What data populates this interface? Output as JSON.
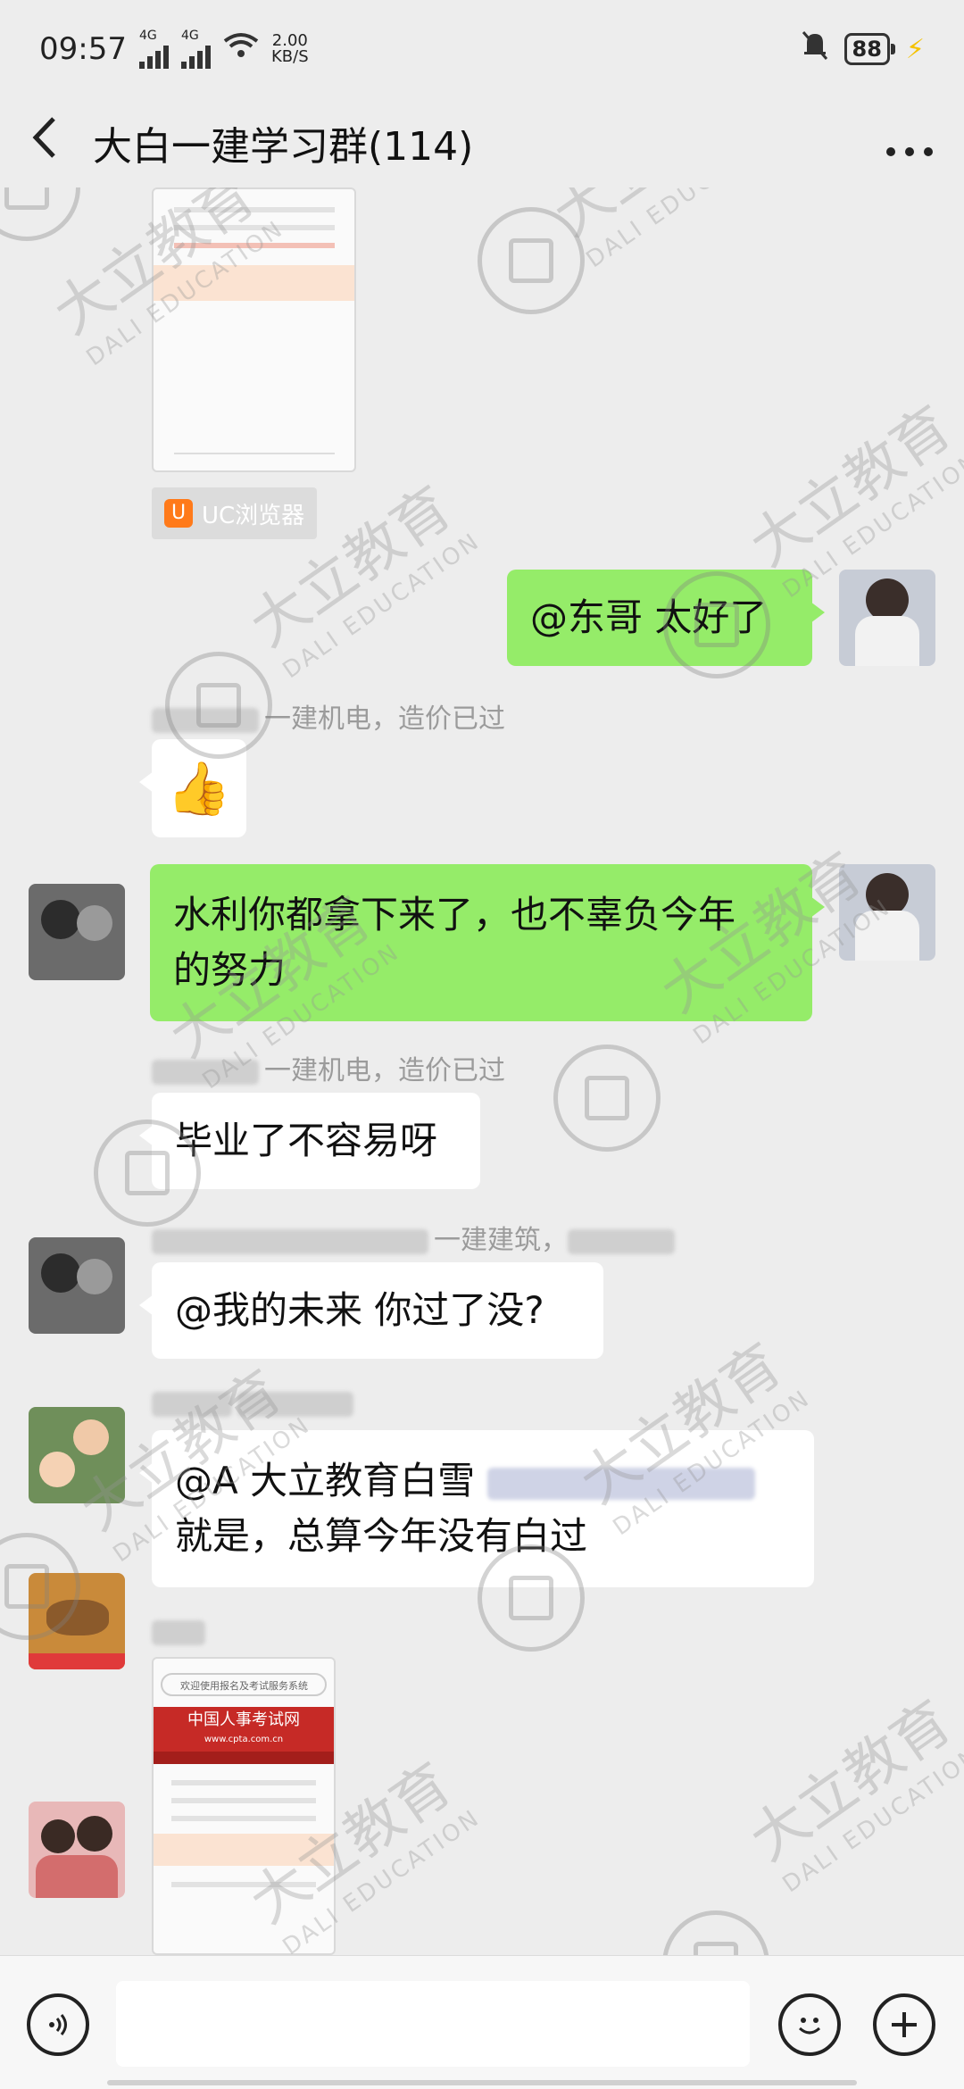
{
  "status_bar": {
    "time": "09:57",
    "net1": "4G",
    "net2": "4G",
    "speed_value": "2.00",
    "speed_unit": "KB/S",
    "battery": "88"
  },
  "header": {
    "title": "大白一建学习群(114)",
    "back_icon": "chevron-left-icon",
    "more_icon": "more-dots-icon"
  },
  "messages": [
    {
      "type": "image",
      "side": "left",
      "source_label": "UC浏览器"
    },
    {
      "type": "text",
      "side": "right",
      "text": "@东哥  太好了"
    },
    {
      "type": "emoji",
      "side": "left",
      "sender_visible": "一建机电，造价已过",
      "emoji": "👍"
    },
    {
      "type": "text",
      "side": "right",
      "text_line1": "水利你都拿下来了，也不辜负今年",
      "text_line2": "的努力"
    },
    {
      "type": "text",
      "side": "left",
      "sender_visible": "一建机电，造价已过",
      "text": "毕业了不容易呀"
    },
    {
      "type": "text",
      "side": "left",
      "sender_visible": "一建建筑，",
      "text": "@我的未来  你过了没?"
    },
    {
      "type": "text",
      "side": "left",
      "text_line1": "@A 大立教育白雪",
      "text_line2": "就是，总算今年没有白过"
    },
    {
      "type": "image",
      "side": "left",
      "site_title": "中国人事考试网",
      "site_url": "www.cpta.com.cn",
      "search_text": "欢迎使用报名及考试服务系统"
    }
  ],
  "watermark": {
    "text": "大立教育",
    "subtext": "DALI EDUCATION"
  },
  "input_bar": {
    "voice_icon": "voice-icon",
    "emoji_icon": "emoji-icon",
    "plus_icon": "plus-icon"
  },
  "colors": {
    "background": "#ededed",
    "bubble_green": "#95ec69",
    "bubble_white": "#ffffff"
  }
}
